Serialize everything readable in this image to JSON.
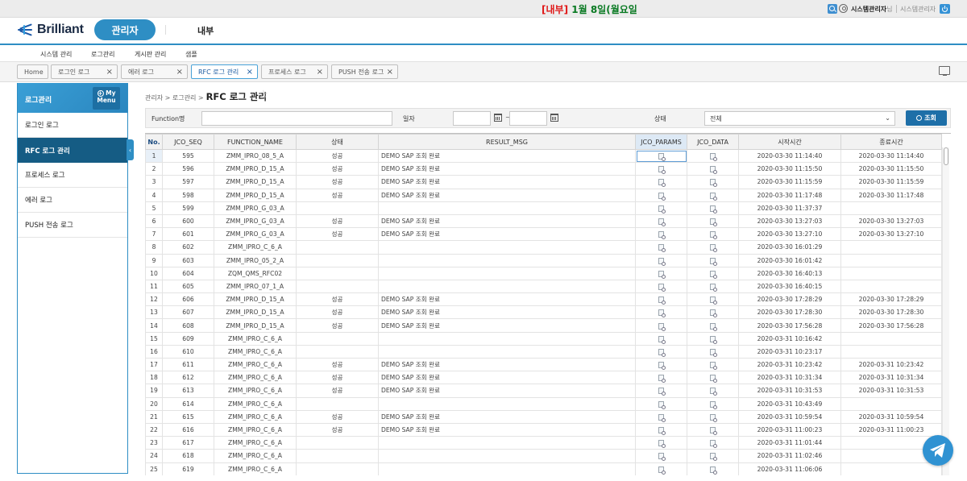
{
  "banner": {
    "prefix": "[내부]",
    "text": "1월 8일(월요일"
  },
  "user": {
    "name": "시스템관리자",
    "suffix": "님",
    "role": "시스템관리자"
  },
  "header": {
    "logo": "Brilliant",
    "admin_tab": "관리자",
    "internal_tab": "내부"
  },
  "menus": [
    "시스템 관리",
    "로그관리",
    "게시판 관리",
    "샘플"
  ],
  "tabs": [
    {
      "label": "Home",
      "closable": false
    },
    {
      "label": "로그인 로그",
      "closable": true
    },
    {
      "label": "에러 로그",
      "closable": true
    },
    {
      "label": "RFC 로그 관리",
      "closable": true,
      "active": true
    },
    {
      "label": "프로세스 로그",
      "closable": true
    },
    {
      "label": "PUSH 전송 로그",
      "closable": true
    }
  ],
  "tab_close_glyph": "×",
  "sidebar": {
    "title": "로그관리",
    "my_menu": [
      "My",
      "Menu"
    ],
    "items": [
      "로그인 로그",
      "RFC 로그 관리",
      "프로세스 로그",
      "에러 로그",
      "PUSH 전송 로그"
    ],
    "active_index": 1
  },
  "breadcrumb": {
    "path": "관리자 > 로그관리 >",
    "title": "RFC 로그 관리"
  },
  "search": {
    "function_label": "Function명",
    "date_label": "일자",
    "date_sep": "~",
    "status_label": "상태",
    "status_value": "전체",
    "button": "조회"
  },
  "grid": {
    "headers": [
      "No.",
      "JCO_SEQ",
      "FUNCTION_NAME",
      "상태",
      "RESULT_MSG",
      "JCO_PARAMS",
      "JCO_DATA",
      "시작시간",
      "종료시간"
    ],
    "rows": [
      [
        "1",
        "595",
        "ZMM_IPRO_08_5_A",
        "성공",
        "DEMO SAP 조회 완료",
        "2020-03-30 11:14:40",
        "2020-03-30 11:14:40"
      ],
      [
        "2",
        "596",
        "ZMM_IPRO_D_15_A",
        "성공",
        "DEMO SAP 조회 완료",
        "2020-03-30 11:15:50",
        "2020-03-30 11:15:50"
      ],
      [
        "3",
        "597",
        "ZMM_IPRO_D_15_A",
        "성공",
        "DEMO SAP 조회 완료",
        "2020-03-30 11:15:59",
        "2020-03-30 11:15:59"
      ],
      [
        "4",
        "598",
        "ZMM_IPRO_D_15_A",
        "성공",
        "DEMO SAP 조회 완료",
        "2020-03-30 11:17:48",
        "2020-03-30 11:17:48"
      ],
      [
        "5",
        "599",
        "ZMM_IPRO_G_03_A",
        "",
        "",
        "2020-03-30 11:37:37",
        ""
      ],
      [
        "6",
        "600",
        "ZMM_IPRO_G_03_A",
        "성공",
        "DEMO SAP 조회 완료",
        "2020-03-30 13:27:03",
        "2020-03-30 13:27:03"
      ],
      [
        "7",
        "601",
        "ZMM_IPRO_G_03_A",
        "성공",
        "DEMO SAP 조회 완료",
        "2020-03-30 13:27:10",
        "2020-03-30 13:27:10"
      ],
      [
        "8",
        "602",
        "ZMM_IPRO_C_6_A",
        "",
        "",
        "2020-03-30 16:01:29",
        ""
      ],
      [
        "9",
        "603",
        "ZMM_IPRO_05_2_A",
        "",
        "",
        "2020-03-30 16:01:42",
        ""
      ],
      [
        "10",
        "604",
        "ZQM_QMS_RFC02",
        "",
        "",
        "2020-03-30 16:40:13",
        ""
      ],
      [
        "11",
        "605",
        "ZMM_IPRO_07_1_A",
        "",
        "",
        "2020-03-30 16:40:15",
        ""
      ],
      [
        "12",
        "606",
        "ZMM_IPRO_D_15_A",
        "성공",
        "DEMO SAP 조회 완료",
        "2020-03-30 17:28:29",
        "2020-03-30 17:28:29"
      ],
      [
        "13",
        "607",
        "ZMM_IPRO_D_15_A",
        "성공",
        "DEMO SAP 조회 완료",
        "2020-03-30 17:28:30",
        "2020-03-30 17:28:30"
      ],
      [
        "14",
        "608",
        "ZMM_IPRO_D_15_A",
        "성공",
        "DEMO SAP 조회 완료",
        "2020-03-30 17:56:28",
        "2020-03-30 17:56:28"
      ],
      [
        "15",
        "609",
        "ZMM_IPRO_C_6_A",
        "",
        "",
        "2020-03-31 10:16:42",
        ""
      ],
      [
        "16",
        "610",
        "ZMM_IPRO_C_6_A",
        "",
        "",
        "2020-03-31 10:23:17",
        ""
      ],
      [
        "17",
        "611",
        "ZMM_IPRO_C_6_A",
        "성공",
        "DEMO SAP 조회 완료",
        "2020-03-31 10:23:42",
        "2020-03-31 10:23:42"
      ],
      [
        "18",
        "612",
        "ZMM_IPRO_C_6_A",
        "성공",
        "DEMO SAP 조회 완료",
        "2020-03-31 10:31:34",
        "2020-03-31 10:31:34"
      ],
      [
        "19",
        "613",
        "ZMM_IPRO_C_6_A",
        "성공",
        "DEMO SAP 조회 완료",
        "2020-03-31 10:31:53",
        "2020-03-31 10:31:53"
      ],
      [
        "20",
        "614",
        "ZMM_IPRO_C_6_A",
        "",
        "",
        "2020-03-31 10:43:49",
        ""
      ],
      [
        "21",
        "615",
        "ZMM_IPRO_C_6_A",
        "성공",
        "DEMO SAP 조회 완료",
        "2020-03-31 10:59:54",
        "2020-03-31 10:59:54"
      ],
      [
        "22",
        "616",
        "ZMM_IPRO_C_6_A",
        "성공",
        "DEMO SAP 조회 완료",
        "2020-03-31 11:00:23",
        "2020-03-31 11:00:23"
      ],
      [
        "23",
        "617",
        "ZMM_IPRO_C_6_A",
        "",
        "",
        "2020-03-31 11:01:44",
        ""
      ],
      [
        "24",
        "618",
        "ZMM_IPRO_C_6_A",
        "",
        "",
        "2020-03-31 11:02:46",
        ""
      ],
      [
        "25",
        "619",
        "ZMM_IPRO_C_6_A",
        "",
        "",
        "2020-03-31 11:06:06",
        ""
      ]
    ],
    "selected_row": 0
  },
  "colors": {
    "accent": "#2e8ec4",
    "sidebar_active": "#155c84",
    "banner_green": "#0a7a23",
    "banner_red": "#e01818"
  },
  "icons": {
    "search": "search-icon",
    "user": "user-icon",
    "logout": "power-icon",
    "desk": "monitor-icon",
    "star": "star-icon",
    "doc": "document-search-icon",
    "calendar": "calendar-icon",
    "telegram": "telegram-icon"
  }
}
